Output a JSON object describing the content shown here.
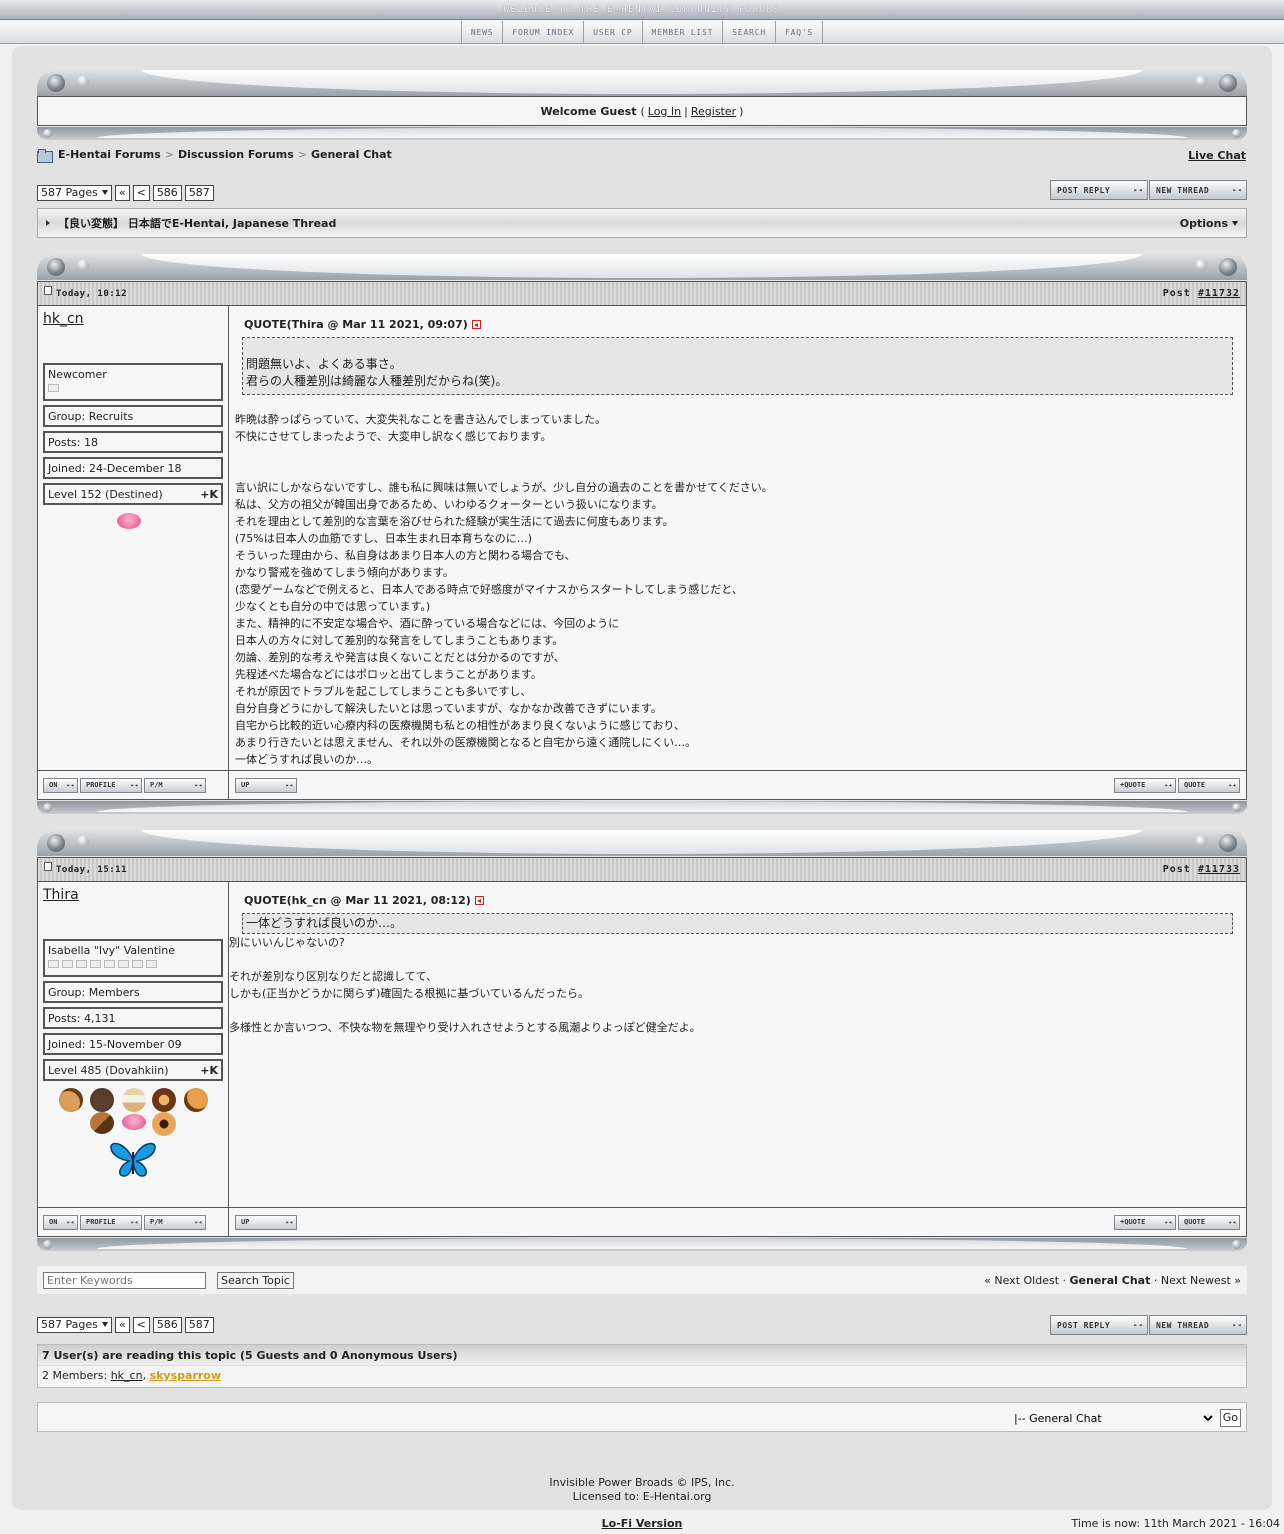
{
  "banner": {
    "text": "WELCOME TO THE E-HENTAI COMMUNITY FORUMS"
  },
  "topnav": [
    "NEWS",
    "FORUM INDEX",
    "USER CP",
    "MEMBER LIST",
    "SEARCH",
    "FAQ'S"
  ],
  "welcome": {
    "text": "Welcome Guest",
    "login": "Log In",
    "register": "Register"
  },
  "breadcrumb": [
    "E-Hentai Forums",
    "Discussion Forums",
    "General Chat"
  ],
  "live_chat": "Live Chat",
  "pager": {
    "pages": "587 Pages",
    "first": "«",
    "prev": "<",
    "p1": "586",
    "p2": "587"
  },
  "buttons": {
    "post_reply": "POST REPLY",
    "new_thread": "NEW THREAD"
  },
  "thread": {
    "title": "【良い変態】 日本語でE-Hentai, Japanese Thread",
    "options": "Options"
  },
  "posts": [
    {
      "time": "Today, 10:12",
      "post_label": "Post",
      "post_no": "#11732",
      "user": "hk_cn",
      "rank": "Newcomer",
      "group": "Group: Recruits",
      "posts": "Posts: 18",
      "joined": "Joined: 24-December 18",
      "level": "Level 152 (Destined)",
      "karma": "+K",
      "quote_head": "QUOTE(Thira @ Mar 11 2021, 09:07)",
      "quote_lines": [
        "問題無いよ、よくある事さ。",
        "君らの人種差別は綺麗な人種差別だからね(笑)。"
      ],
      "lines": [
        "昨晩は酔っぱらっていて、大変失礼なことを書き込んでしまっていました。",
        "不快にさせてしまったようで、大変申し訳なく感じております。",
        "",
        "",
        "言い訳にしかならないですし、誰も私に興味は無いでしょうが、少し自分の過去のことを書かせてください。",
        "私は、父方の祖父が韓国出身であるため、いわゆるクォーターという扱いになります。",
        "それを理由として差別的な言葉を浴びせられた経験が実生活にて過去に何度もあります。",
        "(75%は日本人の血筋ですし、日本生まれ日本育ちなのに…)",
        "そういった理由から、私自身はあまり日本人の方と関わる場合でも、",
        "かなり警戒を強めてしまう傾向があります。",
        "(恋愛ゲームなどで例えると、日本人である時点で好感度がマイナスからスタートしてしまう感じだと、",
        "少なくとも自分の中では思っています。)",
        "また、精神的に不安定な場合や、酒に酔っている場合などには、今回のように",
        "日本人の方々に対して差別的な発言をしてしまうこともあります。",
        "勿論、差別的な考えや発言は良くないことだとは分かるのですが、",
        "先程述べた場合などにはポロッと出てしまうことがあります。",
        "それが原因でトラブルを起こしてしまうことも多いですし、",
        "自分自身どうにかして解決したいとは思っていますが、なかなか改善できずにいます。",
        "自宅から比較的近い心療内科の医療機関も私との相性があまり良くないように感じており、",
        "あまり行きたいとは思えません、それ以外の医療機関となると自宅から遠く通院しにくい…。",
        "一体どうすれば良いのか…。"
      ]
    },
    {
      "time": "Today, 15:11",
      "post_label": "Post",
      "post_no": "#11733",
      "user": "Thira",
      "rank": "Isabella \"Ivy\" Valentine",
      "group": "Group: Members",
      "posts": "Posts: 4,131",
      "joined": "Joined: 15-November 09",
      "level": "Level 485 (Dovahkiin)",
      "karma": "+K",
      "quote_head": "QUOTE(hk_cn @ Mar 11 2021, 08:12)",
      "quote_lines": [
        "一体どうすれば良いのか…。"
      ],
      "lines": [
        "別にいいんじゃないの?",
        "",
        "それが差別なり区別なりだと認識してて、",
        "しかも(正当かどうかに関らず)確固たる根拠に基づいているんだったら。",
        "",
        "多様性とか言いつつ、不快な物を無理やり受け入れさせようとする風潮よりよっぽど健全だよ。"
      ]
    }
  ],
  "post_buttons": {
    "on": "ON",
    "profile": "PROFILE",
    "pm": "P/M",
    "up": "UP",
    "plus_quote": "+QUOTE",
    "quote": "QUOTE"
  },
  "search": {
    "placeholder": "Enter Keywords",
    "button": "Search Topic"
  },
  "topic_nav": {
    "prev": "« Next Oldest",
    "sep": " · ",
    "forum": "General Chat",
    "next": "Next Newest »"
  },
  "readers": {
    "header": "7 User(s) are reading this topic (5 Guests and 0 Anonymous Users)",
    "prefix": "2 Members: ",
    "m1": "hk_cn",
    "m2": "skysparrow"
  },
  "jump": {
    "selected": "|-- General Chat",
    "go": "Go"
  },
  "footer": {
    "line1a": "Invisible Power Broads",
    "line1b": " © IPS, Inc.",
    "line2": "Licensed to: E-Hentai.org",
    "lofi": "Lo-Fi Version",
    "time": "Time is now: 11th March 2021 - 16:04"
  }
}
